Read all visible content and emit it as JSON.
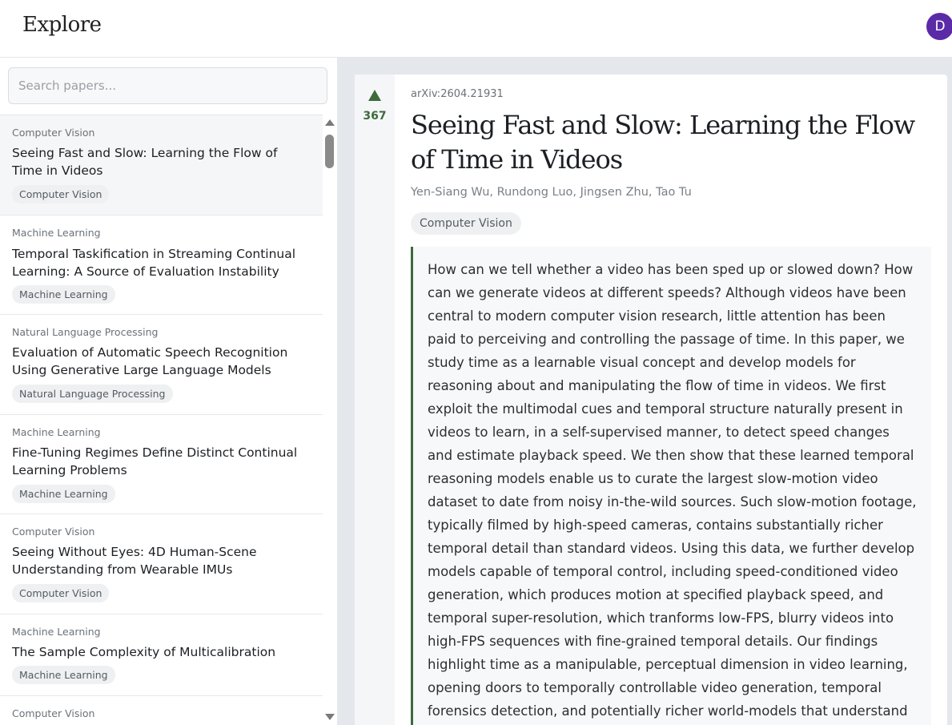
{
  "header": {
    "title": "Explore",
    "avatar_letter": "D"
  },
  "search": {
    "placeholder": "Search papers..."
  },
  "papers": [
    {
      "category": "Computer Vision",
      "title": "Seeing Fast and Slow: Learning the Flow of Time in Videos",
      "tag": "Computer Vision"
    },
    {
      "category": "Machine Learning",
      "title": "Temporal Taskification in Streaming Continual Learning: A Source of Evaluation Instability",
      "tag": "Machine Learning"
    },
    {
      "category": "Natural Language Processing",
      "title": "Evaluation of Automatic Speech Recognition Using Generative Large Language Models",
      "tag": "Natural Language Processing"
    },
    {
      "category": "Machine Learning",
      "title": "Fine-Tuning Regimes Define Distinct Continual Learning Problems",
      "tag": "Machine Learning"
    },
    {
      "category": "Computer Vision",
      "title": "Seeing Without Eyes: 4D Human-Scene Understanding from Wearable IMUs",
      "tag": "Computer Vision"
    },
    {
      "category": "Machine Learning",
      "title": "The Sample Complexity of Multicalibration",
      "tag": "Machine Learning"
    },
    {
      "category": "Computer Vision",
      "title": "",
      "tag": ""
    }
  ],
  "detail": {
    "votes": "367",
    "arxiv_id": "arXiv:2604.21931",
    "title": "Seeing Fast and Slow: Learning the Flow of Time in Videos",
    "authors": "Yen-Siang Wu, Rundong Luo, Jingsen Zhu, Tao Tu",
    "category": "Computer Vision",
    "abstract": "How can we tell whether a video has been sped up or slowed down? How can we generate videos at different speeds? Although videos have been central to modern computer vision research, little attention has been paid to perceiving and controlling the passage of time. In this paper, we study time as a learnable visual concept and develop models for reasoning about and manipulating the flow of time in videos. We first exploit the multimodal cues and temporal structure naturally present in videos to learn, in a self-supervised manner, to detect speed changes and estimate playback speed. We then show that these learned temporal reasoning models enable us to curate the largest slow-motion video dataset to date from noisy in-the-wild sources. Such slow-motion footage, typically filmed by high-speed cameras, contains substantially richer temporal detail than standard videos. Using this data, we further develop models capable of temporal control, including speed-conditioned video generation, which produces motion at specified playback speed, and temporal super-resolution, which tranforms low-FPS, blurry videos into high-FPS sequences with fine-grained temporal details. Our findings highlight time as a manipulable, perceptual dimension in video learning, opening doors to temporally controllable video generation, temporal forensics detection, and potentially richer world-models that understand how events unfold over"
  },
  "colors": {
    "accent": "#3c6b3c",
    "avatar": "#5b2aa6"
  }
}
